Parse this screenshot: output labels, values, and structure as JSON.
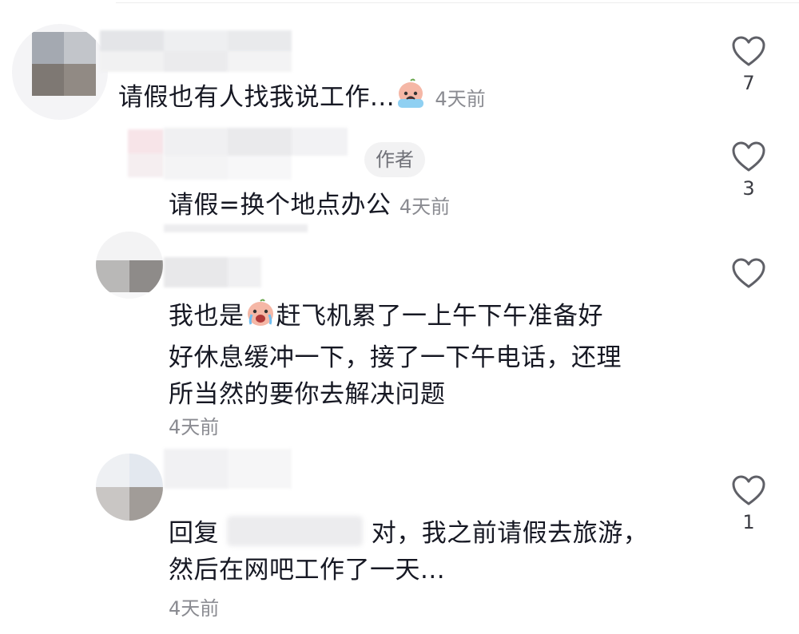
{
  "comments": [
    {
      "text": "请假也有人找我说工作...",
      "time": "4天前",
      "likes": "7",
      "emoji": "crying-baby-emoji"
    },
    {
      "tag": "作者",
      "text": "请假=换个地点办公",
      "time": "4天前",
      "likes": "3"
    },
    {
      "line1_a": "我也是",
      "line1_b": "赶飞机累了一上午下午准备好",
      "line2": "好休息缓冲一下，接了一下午电话，还理",
      "line3": "所当然的要你去解决问题",
      "time": "4天前",
      "emoji": "crying-baby-emoji"
    },
    {
      "reply_prefix": "回复",
      "line1": "对，我之前请假去旅游，",
      "line2": "然后在网吧工作了一天...",
      "time": "4天前",
      "likes": "1"
    }
  ],
  "icons": {
    "like": "heart-outline-icon"
  },
  "colors": {
    "text": "#161823",
    "muted": "#8a8b91",
    "tag_bg": "#f2f2f3"
  }
}
